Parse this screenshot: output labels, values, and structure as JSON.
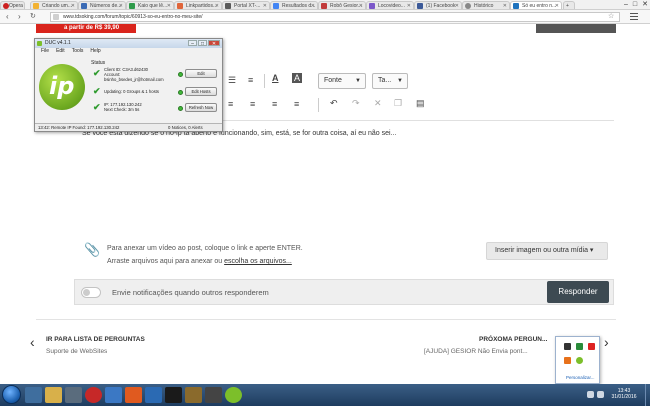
{
  "browser": {
    "tabs": [
      {
        "label": "Opera",
        "active": false
      },
      {
        "label": "Criando um...",
        "active": false
      },
      {
        "label": "Números de...",
        "active": false
      },
      {
        "label": "Kaio que lê...",
        "active": false
      },
      {
        "label": "Linkpartidos...",
        "active": false
      },
      {
        "label": "Portal XT-...",
        "active": false
      },
      {
        "label": "Resultados d...",
        "active": false
      },
      {
        "label": "Robô Gesior...",
        "active": false
      },
      {
        "label": "Locovideo...",
        "active": false
      },
      {
        "label": "(1) Facebook",
        "active": false
      },
      {
        "label": "Histórico",
        "active": false
      },
      {
        "label": "Só eu entro n...",
        "active": true
      }
    ],
    "url": "www.tdsoking.com/forum/topic/60913-so-eu-entro-no-meu-site/"
  },
  "page": {
    "price_badge": "a partir de R$ 39,90",
    "toolbar": {
      "font_dropdown": "Fonte",
      "size_dropdown": "Ta..."
    },
    "editor_text": "Se você está dizendo se o no-ip tá aberto e funcionando, sim, está, se for outra coisa, aí eu não sei...",
    "attach": {
      "line1": "Para anexar um vídeo ao post, coloque o link e aperte ENTER.",
      "line2_prefix": "Arraste arquivos aqui para anexar ou ",
      "line2_link": "escolha os arquivos...",
      "insert_button": "Inserir imagem ou outra mídia ▾"
    },
    "notify_label": "Envie notificações quando outros responderem",
    "reply_button": "Responder",
    "prev": {
      "title": "IR PARA LISTA DE PERGUNTAS",
      "subtitle": "Suporte de WebSites"
    },
    "next": {
      "title": "PRÓXOMA PERGUN...",
      "subtitle": "[AJUDA] GESIOR Não Envia pont..."
    }
  },
  "duc": {
    "title": "DUC v4.1.1",
    "menu": [
      "File",
      "Edit",
      "Tools",
      "Help"
    ],
    "status_label": "Status",
    "rows": [
      {
        "line1": "Client ID: C3A3.d62430",
        "line2": "Account:",
        "line3": "bsinho_bsedes_jr@hotmail.com",
        "button": "Edit"
      },
      {
        "line1": "Updating: 0 Groups & 1 hosts",
        "line2": "",
        "line3": "",
        "button": "Edit Hosts"
      },
      {
        "line1": "IP: 177.192.130.242",
        "line2": "Next Check: 3m 5s",
        "line3": "",
        "button": "Refresh Now"
      }
    ],
    "statusbar_left": "13:42: Remote IP Found: 177.192.130.242",
    "statusbar_right": "0 Notices, 0 Alerts"
  },
  "tray_popup": {
    "customize_link": "Personalizar..."
  },
  "taskbar": {
    "time": "13:43",
    "date": "31/01/2016"
  },
  "colors": {
    "accent_red": "#d9251d",
    "reply_button": "#3d4a52",
    "duc_green": "#6ba71f",
    "taskbar": "#2a4b70"
  }
}
